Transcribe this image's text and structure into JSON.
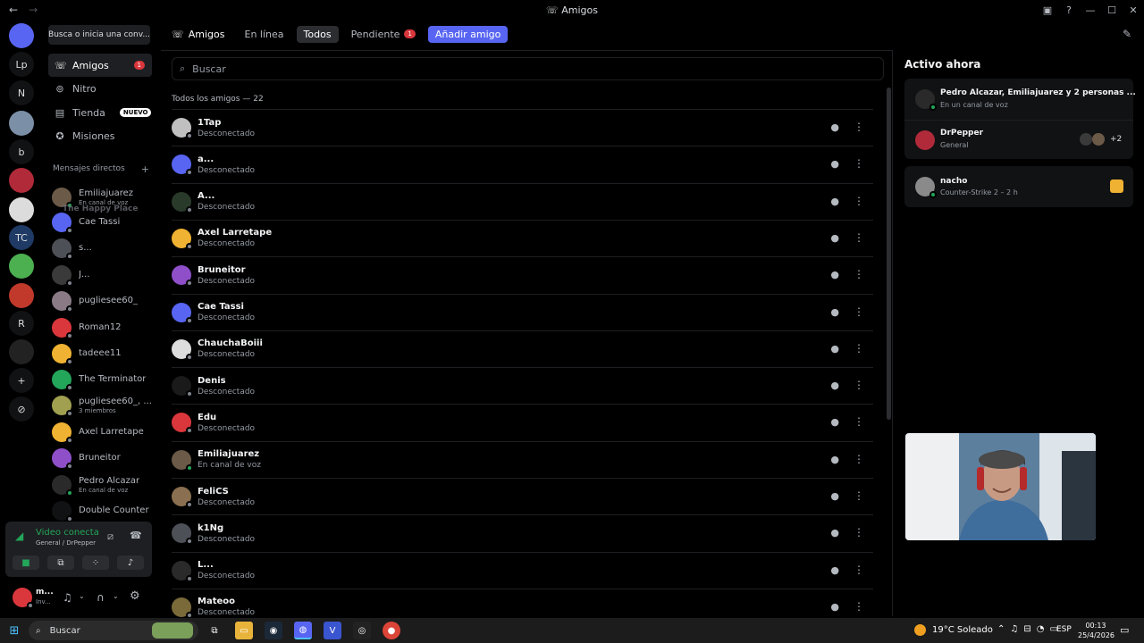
{
  "window": {
    "title": "Amigos",
    "back": "←",
    "forward": "→"
  },
  "rail": {
    "servers": [
      {
        "label": "",
        "badge": "1",
        "color": "#5865f2"
      },
      {
        "label": "Lp",
        "badge": "",
        "color": "#111214"
      },
      {
        "label": "N",
        "badge": "",
        "color": "#111214"
      },
      {
        "label": "",
        "badge": "",
        "color": "#7b8fa6"
      },
      {
        "label": "b",
        "badge": "",
        "color": "#111214"
      },
      {
        "label": "",
        "badge": "",
        "color": "#b02a3a"
      },
      {
        "label": "",
        "badge": "6",
        "color": "#dcdcdc"
      },
      {
        "label": "TC",
        "badge": "",
        "color": "#1f3a64"
      },
      {
        "label": "",
        "badge": "10",
        "color": "#4caf50"
      },
      {
        "label": "",
        "badge": "9K+",
        "color": "#c0392b"
      },
      {
        "label": "R",
        "badge": "",
        "color": "#111214"
      },
      {
        "label": "",
        "badge": "707",
        "color": "#222"
      },
      {
        "label": "+",
        "badge": "",
        "color": "#111214"
      },
      {
        "label": "⊘",
        "badge": "",
        "color": "#111214"
      }
    ]
  },
  "dm_search": {
    "placeholder": "Busca o inicia una conv..."
  },
  "nav": {
    "friends": {
      "label": "Amigos",
      "badge": "1"
    },
    "nitro": {
      "label": "Nitro"
    },
    "shop": {
      "label": "Tienda",
      "tag": "NUEVO"
    },
    "quests": {
      "label": "Misiones"
    }
  },
  "dm_header": {
    "label": "Mensajes directos",
    "plus": "+"
  },
  "drag_ghost": "The Happy Place",
  "dms": [
    {
      "name": "Emiliajuarez",
      "sub": "En canal de voz",
      "color": "#6b5a48",
      "online": true
    },
    {
      "name": "Cae Tassi",
      "sub": "",
      "color": "#5865f2",
      "online": false
    },
    {
      "name": "s...",
      "sub": "",
      "color": "#4e5058",
      "online": false
    },
    {
      "name": "J...",
      "sub": "",
      "color": "#3a3a3a",
      "online": false
    },
    {
      "name": "pugliesee60_",
      "sub": "",
      "color": "#8a7a86",
      "online": false
    },
    {
      "name": "Roman12",
      "sub": "",
      "color": "#da373c",
      "online": false
    },
    {
      "name": "tadeee11",
      "sub": "",
      "color": "#f0b232",
      "online": false
    },
    {
      "name": "The Terminator",
      "sub": "",
      "color": "#23a55a",
      "online": false
    },
    {
      "name": "pugliesee60_, ...",
      "sub": "3 miembros",
      "color": "#a0a050",
      "online": false
    },
    {
      "name": "Axel Larretape",
      "sub": "",
      "color": "#f0b232",
      "online": false
    },
    {
      "name": "Bruneitor",
      "sub": "",
      "color": "#8e4fc9",
      "online": false
    },
    {
      "name": "Pedro Alcazar",
      "sub": "En canal de voz",
      "color": "#2a2a2a",
      "online": true
    },
    {
      "name": "Double Counter",
      "sub": "",
      "color": "#111214",
      "online": false
    }
  ],
  "voice": {
    "title": "Video conectado",
    "channel": "General / DrPepper"
  },
  "user": {
    "name": "m...",
    "status": "Inv..."
  },
  "tabs": {
    "friends": "Amigos",
    "online": "En línea",
    "all": "Todos",
    "pending": "Pendiente",
    "pending_badge": "1",
    "add": "Añadir amigo"
  },
  "search": {
    "placeholder": "Buscar"
  },
  "friends_count": "Todos los amigos — 22",
  "friends": [
    {
      "name": "1Tap",
      "status": "Desconectado",
      "color": "#c0c0c0"
    },
    {
      "name": "a...",
      "status": "Desconectado",
      "color": "#5865f2"
    },
    {
      "name": "A...",
      "status": "Desconectado",
      "color": "#2a3a2a"
    },
    {
      "name": "Axel Larretape",
      "status": "Desconectado",
      "color": "#f0b232"
    },
    {
      "name": "Bruneitor",
      "status": "Desconectado",
      "color": "#8e4fc9"
    },
    {
      "name": "Cae Tassi",
      "status": "Desconectado",
      "color": "#5865f2"
    },
    {
      "name": "ChauchaBoiii",
      "status": "Desconectado",
      "color": "#dddddd"
    },
    {
      "name": "Denis",
      "status": "Desconectado",
      "color": "#1a1a1a"
    },
    {
      "name": "Edu",
      "status": "Desconectado",
      "color": "#da373c"
    },
    {
      "name": "Emiliajuarez",
      "status": "En canal de voz",
      "color": "#6b5a48"
    },
    {
      "name": "FeliCS",
      "status": "Desconectado",
      "color": "#8a7050"
    },
    {
      "name": "k1Ng",
      "status": "Desconectado",
      "color": "#4e5058"
    },
    {
      "name": "L...",
      "status": "Desconectado",
      "color": "#2a2a2a"
    },
    {
      "name": "Mateoo",
      "status": "Desconectado",
      "color": "#7a6a3a"
    }
  ],
  "active_now": {
    "title": "Activo ahora",
    "cards": [
      {
        "name": "Pedro Alcazar, Emiliajuarez y 2 personas ...",
        "sub": "En un canal de voz"
      },
      {
        "name": "DrPepper",
        "sub": "General",
        "extra": "+2"
      },
      {
        "name": "nacho",
        "sub": "Counter-Strike 2 – 2 h"
      }
    ]
  },
  "taskbar": {
    "search": "Buscar",
    "weather": "19°C  Soleado",
    "lang": "ESP",
    "time": "00:13",
    "date": "25/4/2026"
  },
  "colors": {
    "accent": "#5865f2",
    "online": "#23a55a",
    "danger": "#da373c"
  }
}
